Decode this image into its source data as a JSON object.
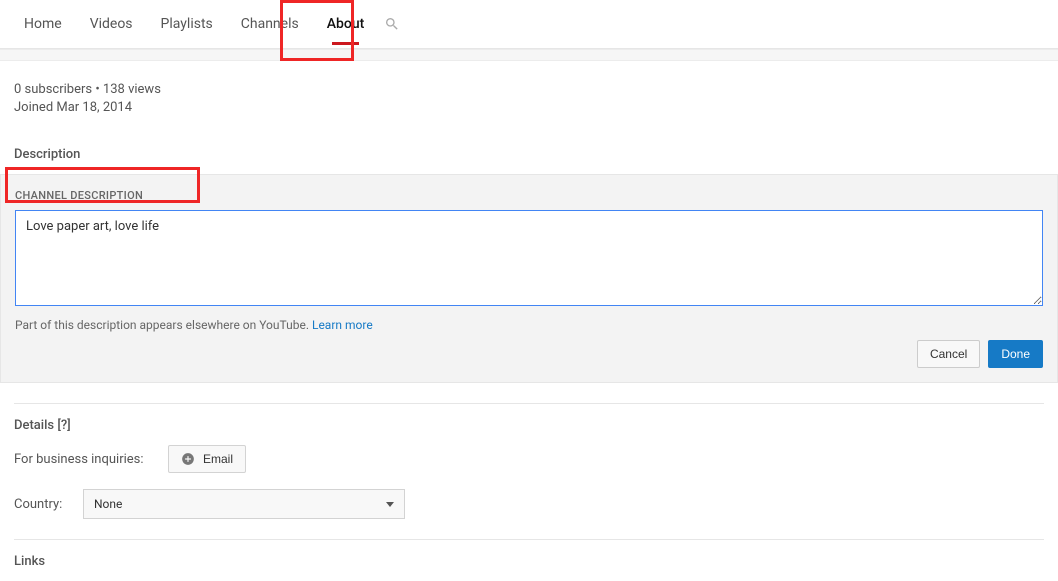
{
  "tabs": {
    "home": "Home",
    "videos": "Videos",
    "playlists": "Playlists",
    "channels": "Channels",
    "about": "About"
  },
  "stats": {
    "subs_views": "0 subscribers • 138 views",
    "joined": "Joined Mar 18, 2014"
  },
  "description": {
    "section_title": "Description",
    "field_label": "CHANNEL DESCRIPTION",
    "value": "Love paper art, love life",
    "help_text": "Part of this description appears elsewhere on YouTube. ",
    "learn_more": "Learn more",
    "cancel": "Cancel",
    "done": "Done"
  },
  "details": {
    "section_title": "Details [?]",
    "biz_label": "For business inquiries:",
    "email_btn": "Email",
    "country_label": "Country:",
    "country_value": "None"
  },
  "links": {
    "section_title": "Links"
  }
}
